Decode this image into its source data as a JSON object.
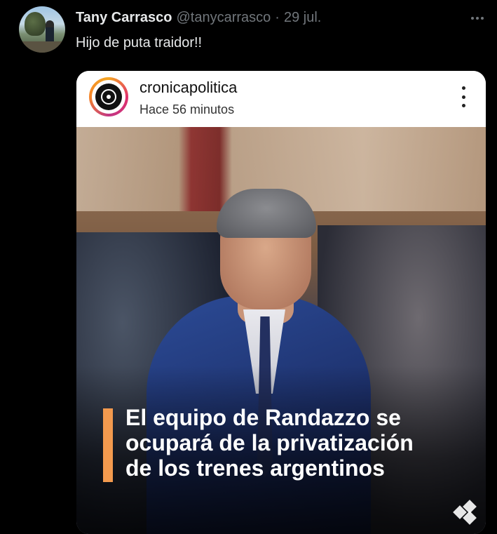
{
  "tweet": {
    "display_name": "Tany Carrasco",
    "handle": "@tanycarrasco",
    "separator": "·",
    "date": "29 jul.",
    "text": "Hijo de puta traidor!!"
  },
  "card": {
    "account": "cronicapolitica",
    "time": "Hace 56 minutos",
    "headline_lines": [
      "El equipo de Randazzo se",
      "ocupará de la privatización",
      "de los trenes argentinos"
    ]
  },
  "colors": {
    "background": "#000000",
    "text_primary": "#e7e9ea",
    "text_secondary": "#71767b",
    "accent_bar": "#f39a4e"
  },
  "icons": {
    "tweet_more": "more-horizontal-icon",
    "card_more": "more-vertical-icon",
    "brand": "cronica-logo-icon",
    "watermark": "brand-diamond-icon"
  }
}
